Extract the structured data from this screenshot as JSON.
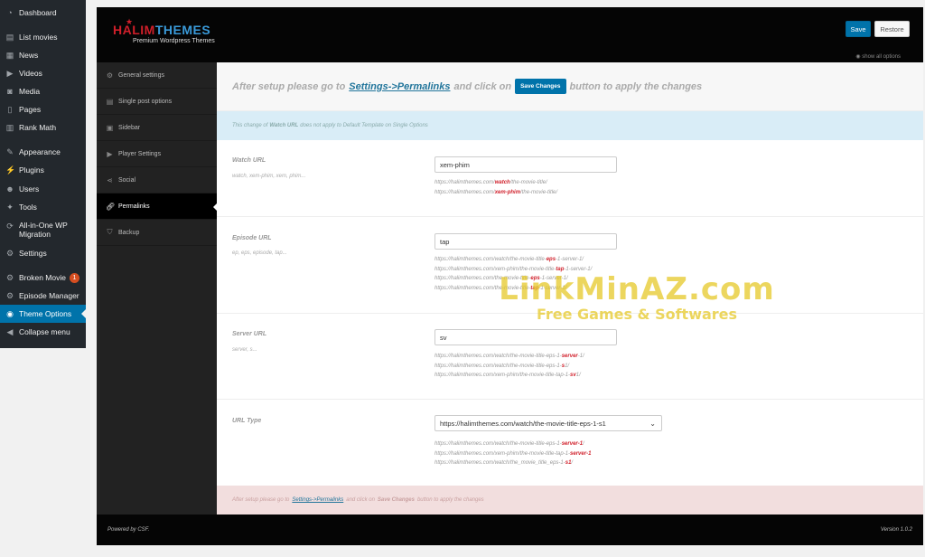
{
  "wp_menu": [
    {
      "label": "Dashboard",
      "icon": "dashboard-icon"
    },
    {
      "label": "List movies",
      "icon": "film-icon"
    },
    {
      "label": "News",
      "icon": "news-icon"
    },
    {
      "label": "Videos",
      "icon": "video-icon"
    },
    {
      "label": "Media",
      "icon": "media-icon"
    },
    {
      "label": "Pages",
      "icon": "pages-icon"
    },
    {
      "label": "Rank Math",
      "icon": "chart-icon"
    },
    {
      "label": "Appearance",
      "icon": "brush-icon"
    },
    {
      "label": "Plugins",
      "icon": "plugin-icon"
    },
    {
      "label": "Users",
      "icon": "users-icon"
    },
    {
      "label": "Tools",
      "icon": "wrench-icon"
    },
    {
      "label": "All-in-One WP",
      "label2": "Migration",
      "icon": "migration-icon"
    },
    {
      "label": "Settings",
      "icon": "settings-icon"
    },
    {
      "label": "Broken Movie",
      "badge": "1",
      "icon": "gear-icon"
    },
    {
      "label": "Episode Manager",
      "icon": "gear-icon"
    },
    {
      "label": "Theme Options",
      "icon": "theme-options-icon"
    },
    {
      "label": "Collapse menu",
      "icon": "collapse-icon"
    }
  ],
  "header": {
    "logo_part1": "HALIM",
    "logo_part2": "THEMES",
    "logo_tagline": "Premium Wordpress Themes",
    "save_label": "Save",
    "restore_label": "Restore",
    "show_all": "show all options"
  },
  "nav": [
    {
      "label": "General settings",
      "icon": "gear-icon"
    },
    {
      "label": "Single post options",
      "icon": "post-icon"
    },
    {
      "label": "Sidebar",
      "icon": "sidebar-icon"
    },
    {
      "label": "Player Settings",
      "icon": "youtube-icon"
    },
    {
      "label": "Social",
      "icon": "share-icon"
    },
    {
      "label": "Permalinks",
      "icon": "link-icon"
    },
    {
      "label": "Backup",
      "icon": "shield-icon"
    }
  ],
  "notice_top": {
    "pre": "After setup please go to",
    "link": "Settings->Permalinks",
    "mid": "and click on",
    "button": "Save Changes",
    "post": "button to apply the changes"
  },
  "info_bar": {
    "pre": "This change of",
    "bold": "Watch URL",
    "post": "does not apply to Default Template on Single Options"
  },
  "fields": {
    "watch": {
      "title": "Watch URL",
      "desc": "watch, xem-phim, xem, phim...",
      "value": "xem-phim",
      "help1_pre": "https://halimthemes.com/",
      "help1_hl": "watch",
      "help1_post": "/the-movie-title/",
      "help2_pre": "https://halimthemes.com/",
      "help2_hl": "xem-phim",
      "help2_post": "/the-movie-title/"
    },
    "episode": {
      "title": "Episode URL",
      "desc": "ep, eps, episode, tap...",
      "value": "tap",
      "h1_pre": "https://halimthemes.com/watch/the-movie-title-",
      "h1_hl": "eps",
      "h1_post": "-1-server-1/",
      "h2_pre": "https://halimthemes.com/xem-phim/the-movie-title-",
      "h2_hl": "tap",
      "h2_post": "-1-server-1/",
      "h3_pre": "https://halimthemes.com/the-movie-title-",
      "h3_hl": "eps",
      "h3_post": "-1-server-1/",
      "h4_pre": "https://halimthemes.com/the-movie-title-",
      "h4_hl": "tap",
      "h4_post": "-1-server-1/"
    },
    "server": {
      "title": "Server URL",
      "desc": "server, s...",
      "value": "sv",
      "h1_pre": "https://halimthemes.com/watch/the-movie-title-eps-1-",
      "h1_hl": "server",
      "h1_post": "-1/",
      "h2_pre": "https://halimthemes.com/watch/the-movie-title-eps-1-",
      "h2_hl": "s",
      "h2_post": "1/",
      "h3_pre": "https://halimthemes.com/xem-phim/the-movie-title-tap-1-",
      "h3_hl": "sv",
      "h3_post": "1/"
    },
    "urltype": {
      "title": "URL Type",
      "value": "https://halimthemes.com/watch/the-movie-title-eps-1-s1",
      "h1_pre": "https://halimthemes.com/watch/the-movie-title-eps-1-",
      "h1_hl": "server-1",
      "h1_post": "/",
      "h2_pre": "https://halimthemes.com/xem-phim/the-movie-title-tap-1-",
      "h2_hl": "server-1",
      "h2_post": "",
      "h3_pre": "https://halimthemes.com/watch/the_movie_title_eps-1-",
      "h3_hl": "s1",
      "h3_post": "/"
    }
  },
  "notice_bottom": {
    "pre": "After setup please go to",
    "link": "Settings->Permalinks",
    "mid": "and click on",
    "bold": "Save Changes",
    "post": "button to apply the changes"
  },
  "footer": {
    "left": "Powered by CSF.",
    "right": "Version 1.0.2"
  },
  "watermark": {
    "line1": "LinkMinAZ.com",
    "line2": "Free Games & Softwares"
  },
  "colors": {
    "accent": "#0073aa",
    "highlight": "#d01f2a",
    "wp_sidebar": "#23282d"
  }
}
